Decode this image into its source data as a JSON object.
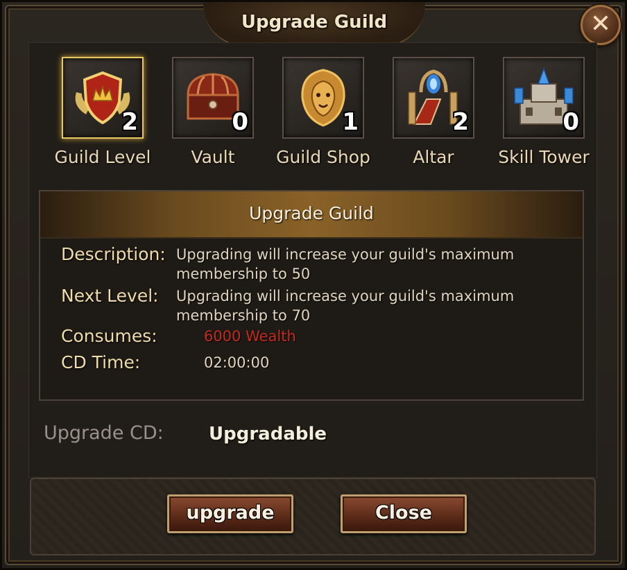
{
  "window": {
    "title": "Upgrade Guild",
    "close_icon": "✕"
  },
  "buildings": [
    {
      "name": "Guild Level",
      "count": "2",
      "icon": "shield-crown-icon",
      "selected": true
    },
    {
      "name": "Vault",
      "count": "0",
      "icon": "treasure-chest-icon",
      "selected": false
    },
    {
      "name": "Guild Shop",
      "count": "1",
      "icon": "lion-emblem-icon",
      "selected": false
    },
    {
      "name": "Altar",
      "count": "2",
      "icon": "altar-icon",
      "selected": false
    },
    {
      "name": "Skill Tower",
      "count": "0",
      "icon": "skill-tower-icon",
      "selected": false
    }
  ],
  "panel": {
    "title": "Upgrade Guild",
    "description_label": "Description:",
    "description_line1": "Upgrading will increase your guild's maximum",
    "description_line2": "membership to 50",
    "next_level_label": "Next Level:",
    "next_level_line1": "Upgrading will increase your guild's maximum",
    "next_level_line2": "membership to 70",
    "consumes_label": "Consumes:",
    "consumes_value": "6000 Wealth",
    "cd_time_label": "CD Time:",
    "cd_time_value": "02:00:00"
  },
  "upgrade_cd": {
    "label": "Upgrade CD:",
    "value": "Upgradable"
  },
  "buttons": {
    "upgrade": "upgrade",
    "close": "Close"
  },
  "colors": {
    "gold_accent": "#e8c860",
    "consume_red": "#c42c1c",
    "button_brown": "#8a4a30"
  }
}
